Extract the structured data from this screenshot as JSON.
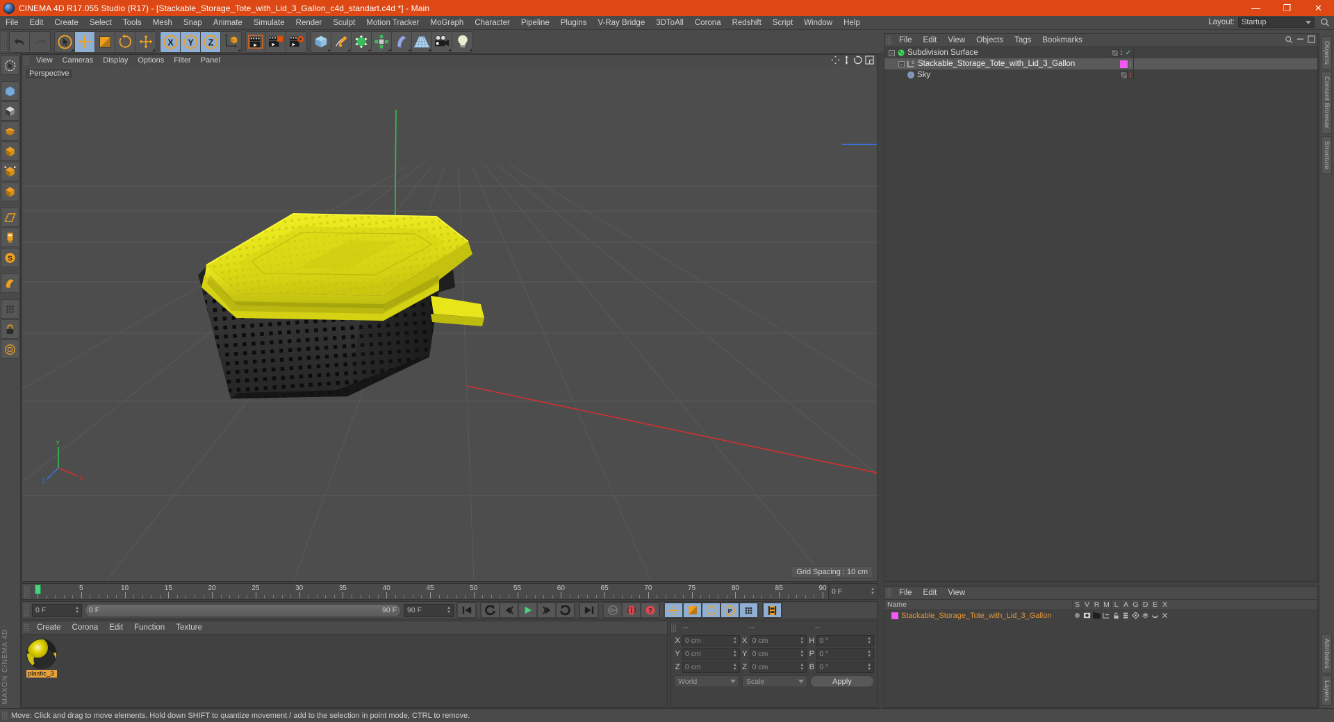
{
  "window": {
    "title": "CINEMA 4D R17.055 Studio (R17) - [Stackable_Storage_Tote_with_Lid_3_Gallon_c4d_standart.c4d *] - Main",
    "minimize": "—",
    "maximize": "❐",
    "close": "✕"
  },
  "menubar": {
    "items": [
      "File",
      "Edit",
      "Create",
      "Select",
      "Tools",
      "Mesh",
      "Snap",
      "Animate",
      "Simulate",
      "Render",
      "Sculpt",
      "Motion Tracker",
      "MoGraph",
      "Character",
      "Pipeline",
      "Plugins",
      "V-Ray Bridge",
      "3DToAll",
      "Corona",
      "Redshift",
      "Script",
      "Window",
      "Help"
    ],
    "layout_label": "Layout:",
    "layout_value": "Startup"
  },
  "toolbar": {
    "groups": [
      {
        "name": "history",
        "buttons": [
          {
            "icon": "undo-icon"
          },
          {
            "icon": "redo-icon"
          }
        ]
      },
      {
        "name": "tools",
        "buttons": [
          {
            "icon": "select-icon"
          },
          {
            "icon": "move-icon",
            "active": true
          },
          {
            "icon": "scale-icon"
          },
          {
            "icon": "rotate-icon"
          },
          {
            "icon": "move-axis-icon"
          }
        ]
      },
      {
        "name": "axis-locks",
        "buttons": [
          {
            "icon": "axis-x-icon",
            "active": true,
            "label": "X"
          },
          {
            "icon": "axis-y-icon",
            "active": true,
            "label": "Y"
          },
          {
            "icon": "axis-z-icon",
            "active": true,
            "label": "Z"
          },
          {
            "icon": "world-coord-icon"
          }
        ]
      },
      {
        "name": "render",
        "buttons": [
          {
            "icon": "render-view-icon"
          },
          {
            "icon": "render-region-icon"
          },
          {
            "icon": "render-settings-icon"
          }
        ]
      },
      {
        "name": "create",
        "buttons": [
          {
            "icon": "cube-icon"
          },
          {
            "icon": "spline-pen-icon"
          },
          {
            "icon": "nurbs-icon"
          },
          {
            "icon": "array-icon"
          },
          {
            "icon": "bend-deformer-icon"
          },
          {
            "icon": "floor-icon"
          },
          {
            "icon": "camera-icon"
          },
          {
            "icon": "light-icon"
          }
        ]
      }
    ]
  },
  "left_palette": {
    "buttons": [
      {
        "icon": "live-selection-icon"
      },
      {
        "icon": "point-mode-icon"
      },
      {
        "icon": "edge-mode-icon"
      },
      {
        "icon": "polygon-mode-icon"
      },
      {
        "icon": "model-mode-icon"
      },
      {
        "icon": "object-mode-icon"
      },
      {
        "icon": "texture-mode-icon"
      },
      {
        "icon": "workplane-icon"
      },
      {
        "icon": "axis-modify-icon"
      },
      {
        "icon": "enable-snap-icon"
      },
      {
        "icon": "deform-icon"
      },
      {
        "icon": "viewport-solo-icon"
      },
      {
        "icon": "lock-icon"
      },
      {
        "icon": "uv-icon"
      }
    ],
    "brand": "MAXON CINEMA 4D"
  },
  "viewport": {
    "menu": [
      "View",
      "Cameras",
      "Display",
      "Options",
      "Filter",
      "Panel"
    ],
    "label": "Perspective",
    "grid_spacing": "Grid Spacing : 10 cm",
    "corner_icons": [
      "pan-icon",
      "zoom-icon",
      "rotate-view-icon",
      "maximize-view-icon"
    ],
    "axis_labels": {
      "y": "Y",
      "x": "X",
      "z": "Z"
    }
  },
  "object_manager": {
    "menu": [
      "File",
      "Edit",
      "View",
      "Objects",
      "Tags",
      "Bookmarks"
    ],
    "items": [
      {
        "name": "Subdivision Surface",
        "icon": "subdivision-surface-icon",
        "selected": false,
        "depth": 0,
        "swatch": "#5a5a5a",
        "expanded": true
      },
      {
        "name": "Stackable_Storage_Tote_with_Lid_3_Gallon",
        "icon": "polygon-object-icon",
        "selected": true,
        "depth": 1,
        "swatch": "#f15bf1",
        "expanded": true
      },
      {
        "name": "Sky",
        "icon": "sky-icon",
        "selected": false,
        "depth": 1,
        "swatch": "#5a5a5a",
        "expanded": false
      }
    ]
  },
  "right_tabs": [
    "Objects",
    "Content Browser",
    "Structure"
  ],
  "right_tabs_bottom": [
    "Attributes",
    "Layers"
  ],
  "timeline": {
    "ticks": [
      0,
      5,
      10,
      15,
      20,
      25,
      30,
      35,
      40,
      45,
      50,
      55,
      60,
      65,
      70,
      75,
      80,
      85,
      90
    ],
    "current_frame_label": "0 F",
    "min": 0,
    "max": 90
  },
  "transport": {
    "current_frame": "0 F",
    "range_start": "0 F",
    "range_end": "90 F",
    "max_frame": "90 F",
    "buttons": [
      {
        "icon": "go-to-start-icon"
      },
      {
        "icon": "step-back-keyframe-icon"
      },
      {
        "icon": "step-back-frame-icon"
      },
      {
        "icon": "play-icon"
      },
      {
        "icon": "step-forward-frame-icon"
      },
      {
        "icon": "step-forward-keyframe-icon"
      },
      {
        "icon": "go-to-end-icon"
      },
      {
        "icon": "record-key-icon"
      },
      {
        "icon": "autokey-icon"
      },
      {
        "icon": "keyframe-selection-icon"
      },
      {
        "icon": "position-key-icon",
        "active": true
      },
      {
        "icon": "scale-key-icon",
        "active": true
      },
      {
        "icon": "rotation-key-icon",
        "active": true
      },
      {
        "icon": "pla-key-icon",
        "active": true
      },
      {
        "icon": "point-level-anim-icon",
        "active": true
      },
      {
        "icon": "timeline-icon",
        "active": true
      }
    ]
  },
  "material_manager": {
    "menu": [
      "Create",
      "Corona",
      "Edit",
      "Function",
      "Texture"
    ],
    "materials": [
      {
        "name": "plastic_3"
      }
    ]
  },
  "coordinates": {
    "headers": [
      "--",
      "--",
      "--"
    ],
    "rows": [
      {
        "label1": "X",
        "value1": "0 cm",
        "label2": "X",
        "value2": "0 cm",
        "label3": "H",
        "value3": "0 °"
      },
      {
        "label1": "Y",
        "value1": "0 cm",
        "label2": "Y",
        "value2": "0 cm",
        "label3": "P",
        "value3": "0 °"
      },
      {
        "label1": "Z",
        "value1": "0 cm",
        "label2": "Z",
        "value2": "0 cm",
        "label3": "B",
        "value3": "0 °"
      }
    ],
    "coord_system": "World",
    "mode": "Scale",
    "apply": "Apply"
  },
  "layer_manager": {
    "menu": [
      "File",
      "Edit",
      "View"
    ],
    "name_header": "Name",
    "columns": [
      "S",
      "V",
      "R",
      "M",
      "L",
      "A",
      "G",
      "D",
      "E",
      "X"
    ],
    "rows": [
      {
        "name": "Stackable_Storage_Tote_with_Lid_3_Gallon",
        "swatch": "#f15bf1"
      }
    ]
  },
  "statusbar": {
    "text": "Move: Click and drag to move elements. Hold down SHIFT to quantize movement / add to the selection in point mode, CTRL to remove."
  },
  "colors": {
    "accent": "#dd4814",
    "panel": "#414141",
    "toolbar": "#4a4a4a",
    "viewport": "#4d4d4d",
    "active_button": "#8fafd4",
    "lid": "#e8e82a",
    "body": "#2e2e2e"
  }
}
